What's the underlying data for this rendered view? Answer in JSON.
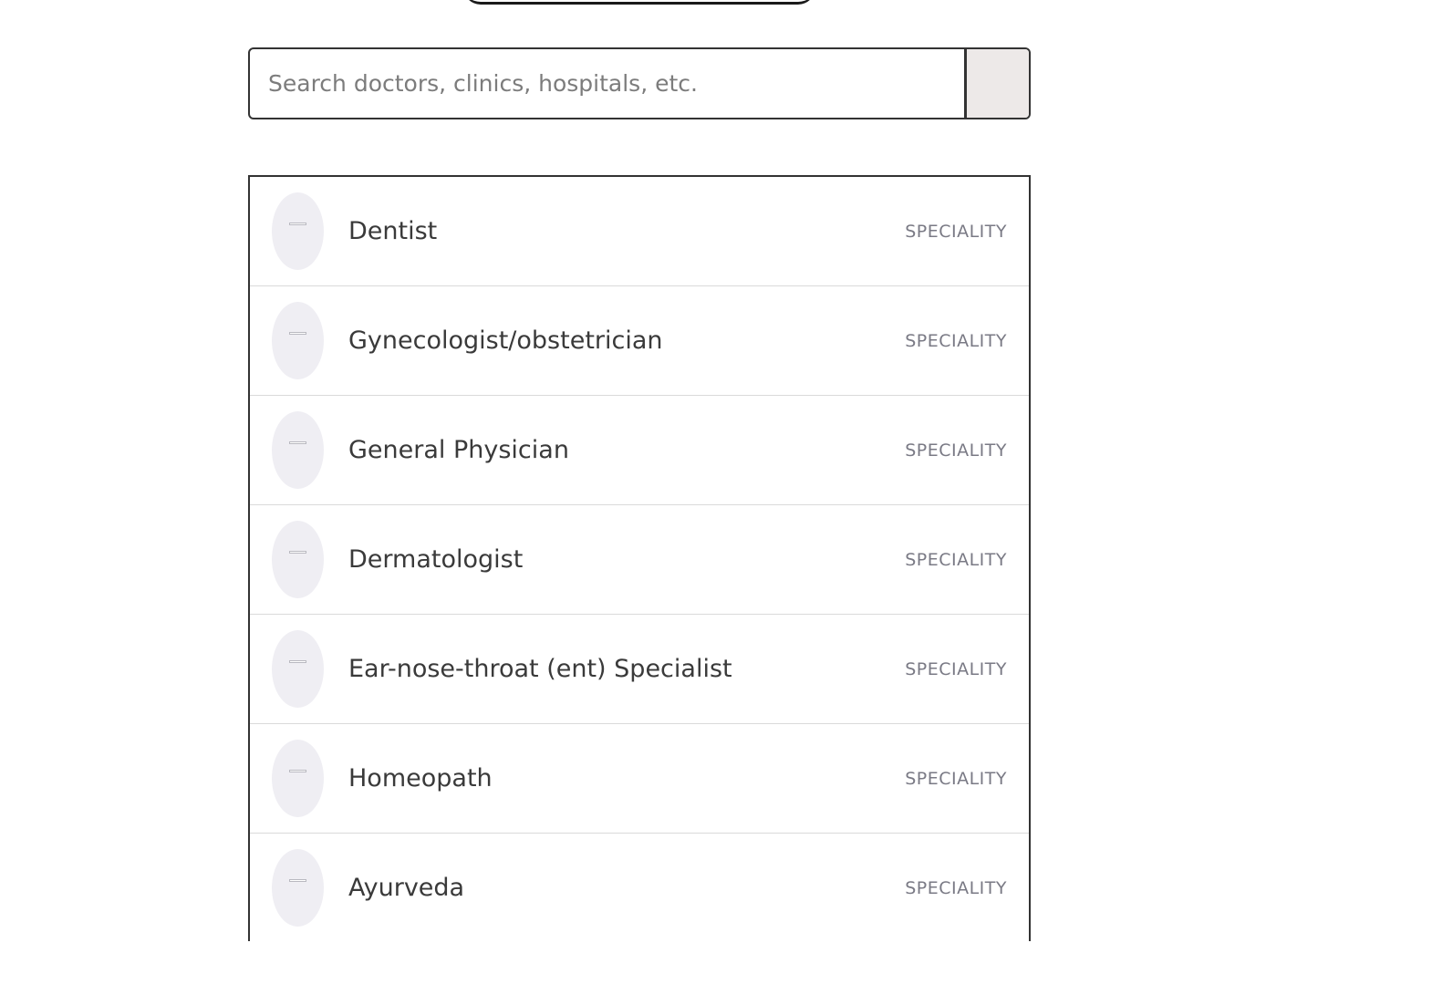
{
  "search": {
    "placeholder": "Search doctors, clinics, hospitals, etc.",
    "value": ""
  },
  "results": {
    "items": [
      {
        "label": "Dentist",
        "type": "SPECIALITY"
      },
      {
        "label": "Gynecologist/obstetrician",
        "type": "SPECIALITY"
      },
      {
        "label": "General Physician",
        "type": "SPECIALITY"
      },
      {
        "label": "Dermatologist",
        "type": "SPECIALITY"
      },
      {
        "label": "Ear-nose-throat (ent) Specialist",
        "type": "SPECIALITY"
      },
      {
        "label": "Homeopath",
        "type": "SPECIALITY"
      },
      {
        "label": "Ayurveda",
        "type": "SPECIALITY"
      }
    ]
  },
  "colors": {
    "border": "#333333",
    "search_button_bg": "#ede9e8",
    "thumb_bg": "#efeef3",
    "label_text": "#3a3a3a",
    "type_text": "#7a7a85"
  },
  "icons": {
    "thumb": "placeholder-image-icon"
  }
}
